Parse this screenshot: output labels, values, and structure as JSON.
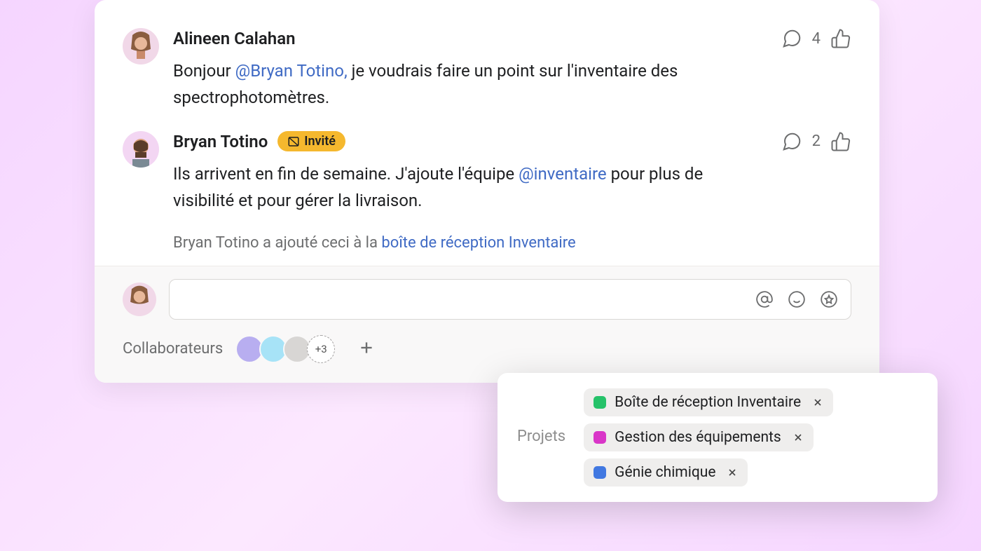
{
  "comments": [
    {
      "author": "Alineen Calahan",
      "likes": "4",
      "text_before": "Bonjour ",
      "mention": "@Bryan Totino,",
      "text_after": " je voudrais faire un point sur l'inventaire des spectrophotomètres."
    },
    {
      "author": "Bryan Totino",
      "guest_label": "Invité",
      "likes": "2",
      "text_before": "Ils arrivent en fin de semaine. J'ajoute l'équipe ",
      "mention": "@inventaire",
      "text_after": " pour plus de visibilité et pour gérer la livraison."
    }
  ],
  "activity": {
    "prefix": "Bryan Totino a ajouté ceci à la ",
    "link": "boîte de réception Inventaire"
  },
  "collaborators": {
    "label": "Collaborateurs",
    "more": "+3"
  },
  "projects": {
    "label": "Projets",
    "items": [
      {
        "name": "Boîte de réception Inventaire",
        "color": "green"
      },
      {
        "name": "Gestion des équipements",
        "color": "magenta"
      },
      {
        "name": "Génie chimique",
        "color": "blue"
      }
    ]
  }
}
